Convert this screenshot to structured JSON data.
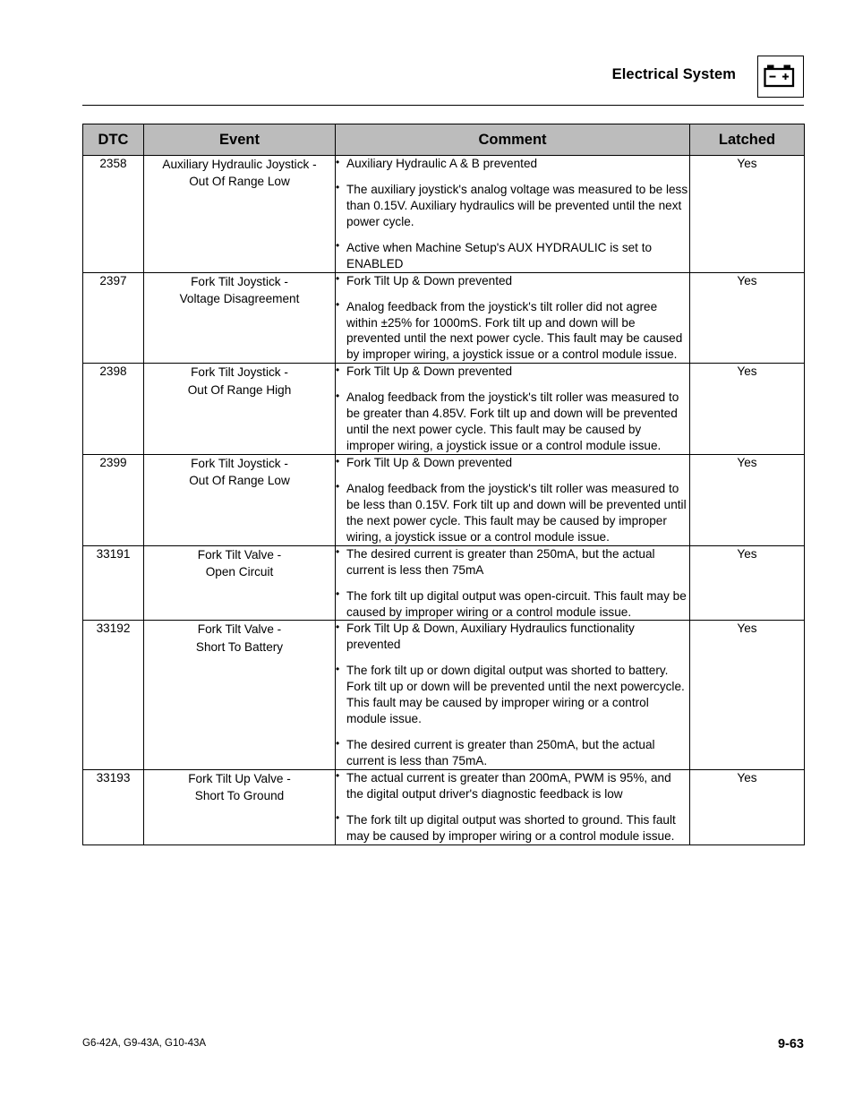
{
  "header": {
    "title": "Electrical System",
    "icon": "battery-icon"
  },
  "table": {
    "columns": [
      "DTC",
      "Event",
      "Comment",
      "Latched"
    ],
    "rows": [
      {
        "dtc": "2358",
        "event": "Auxiliary Hydraulic Joystick -\nOut Of Range Low",
        "comments": [
          "Auxiliary Hydraulic A & B prevented",
          "The auxiliary joystick's analog voltage was measured to be less than 0.15V. Auxiliary hydraulics will be prevented until the next power cycle.",
          "Active when Machine Setup's AUX HYDRAULIC is set to ENABLED"
        ],
        "latched": "Yes"
      },
      {
        "dtc": "2397",
        "event": "Fork Tilt Joystick -\nVoltage Disagreement",
        "comments": [
          "Fork Tilt Up & Down prevented",
          "Analog feedback from the joystick's tilt roller did not agree within ±25% for 1000mS. Fork tilt up and down will be prevented until the next power cycle. This fault may be caused by improper wiring, a joystick issue or a control module issue."
        ],
        "latched": "Yes"
      },
      {
        "dtc": "2398",
        "event": "Fork Tilt Joystick -\nOut Of Range High",
        "comments": [
          "Fork Tilt Up & Down prevented",
          "Analog feedback from the joystick's tilt roller was measured to be greater than 4.85V. Fork tilt up and down will be prevented until the next power cycle. This fault may be caused by improper wiring, a joystick issue or a control module issue."
        ],
        "latched": "Yes"
      },
      {
        "dtc": "2399",
        "event": "Fork Tilt Joystick -\nOut Of Range Low",
        "comments": [
          "Fork Tilt Up & Down prevented",
          "Analog feedback from the joystick's tilt roller was measured to be less than 0.15V. Fork tilt up and down will be prevented until the next power cycle. This fault may be caused by improper wiring, a joystick issue or a control module issue."
        ],
        "latched": "Yes"
      },
      {
        "dtc": "33191",
        "event": "Fork Tilt Valve -\nOpen Circuit",
        "comments": [
          "The desired current is greater than 250mA, but the actual current is less then 75mA",
          "The fork tilt up digital output was open-circuit. This fault may be caused by improper wiring or a control module issue."
        ],
        "latched": "Yes"
      },
      {
        "dtc": "33192",
        "event": "Fork Tilt Valve -\nShort To Battery",
        "comments": [
          "Fork Tilt Up & Down, Auxiliary Hydraulics functionality prevented",
          "The fork tilt up or down digital output was shorted to battery. Fork tilt up or down will be prevented until the next powercycle. This fault may be caused by improper wiring or a control module issue.",
          "The desired current is greater than 250mA, but the actual current is less than 75mA."
        ],
        "latched": "Yes"
      },
      {
        "dtc": "33193",
        "event": "Fork Tilt Up Valve -\nShort To Ground",
        "comments": [
          "The actual current is greater than 200mA, PWM is 95%, and the digital output driver's diagnostic feedback is low",
          "The fork tilt up digital output was shorted to ground. This fault may be caused by improper wiring or a control module issue."
        ],
        "latched": "Yes"
      }
    ]
  },
  "footer": {
    "models": "G6-42A, G9-43A, G10-43A",
    "page": "9-63"
  },
  "colors": {
    "header_fill": "#bcbcbc",
    "rule": "#000000",
    "text": "#000000"
  }
}
